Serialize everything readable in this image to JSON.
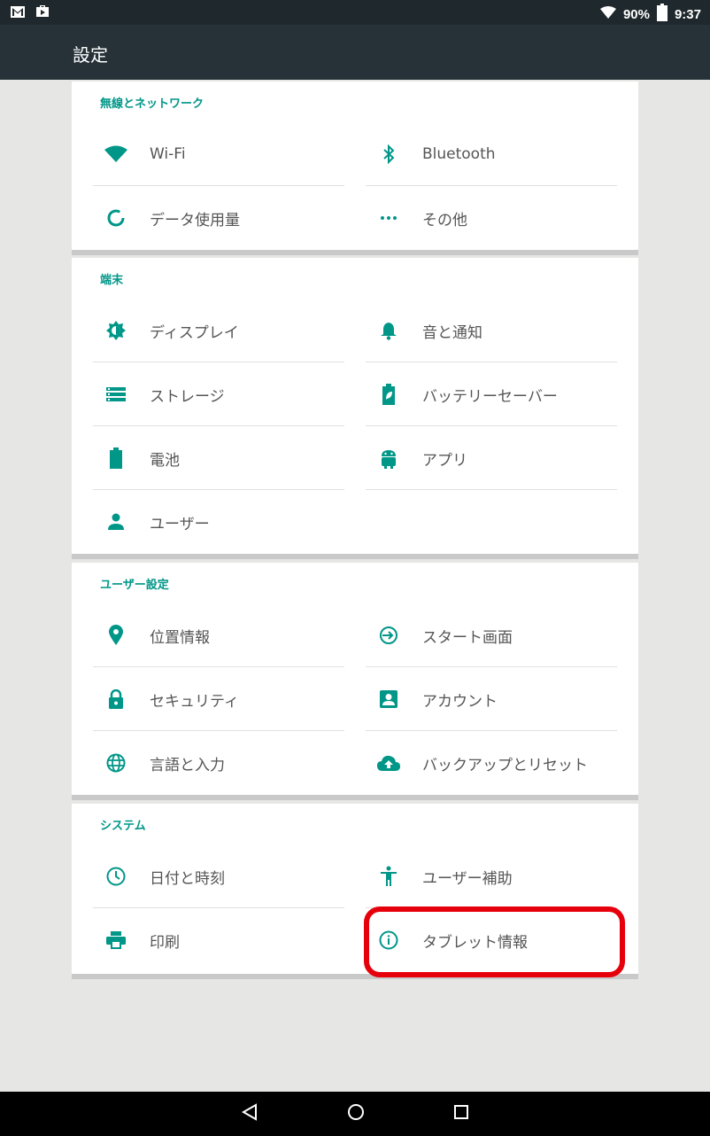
{
  "status_bar": {
    "battery_percent": "90%",
    "time": "9:37"
  },
  "app_bar": {
    "title": "設定"
  },
  "sections": [
    {
      "header": "無線とネットワーク",
      "items": [
        {
          "label": "Wi-Fi",
          "icon": "wifi-icon"
        },
        {
          "label": "Bluetooth",
          "icon": "bluetooth-icon"
        },
        {
          "label": "データ使用量",
          "icon": "data-usage-icon"
        },
        {
          "label": "その他",
          "icon": "more-icon"
        }
      ]
    },
    {
      "header": "端末",
      "items": [
        {
          "label": "ディスプレイ",
          "icon": "brightness-icon"
        },
        {
          "label": "音と通知",
          "icon": "bell-icon"
        },
        {
          "label": "ストレージ",
          "icon": "storage-icon"
        },
        {
          "label": "バッテリーセーバー",
          "icon": "battery-saver-icon"
        },
        {
          "label": "電池",
          "icon": "battery-icon"
        },
        {
          "label": "アプリ",
          "icon": "android-icon"
        },
        {
          "label": "ユーザー",
          "icon": "person-icon"
        }
      ]
    },
    {
      "header": "ユーザー設定",
      "items": [
        {
          "label": "位置情報",
          "icon": "location-icon"
        },
        {
          "label": "スタート画面",
          "icon": "login-icon"
        },
        {
          "label": "セキュリティ",
          "icon": "lock-icon"
        },
        {
          "label": "アカウント",
          "icon": "account-box-icon"
        },
        {
          "label": "言語と入力",
          "icon": "globe-icon"
        },
        {
          "label": "バックアップとリセット",
          "icon": "cloud-upload-icon"
        }
      ]
    },
    {
      "header": "システム",
      "items": [
        {
          "label": "日付と時刻",
          "icon": "clock-icon"
        },
        {
          "label": "ユーザー補助",
          "icon": "accessibility-icon"
        },
        {
          "label": "印刷",
          "icon": "print-icon"
        },
        {
          "label": "タブレット情報",
          "icon": "info-icon"
        }
      ]
    }
  ],
  "colors": {
    "accent": "#009688",
    "app_bar": "#263238",
    "status_bar": "#1f282c",
    "highlight": "#e6000c"
  }
}
